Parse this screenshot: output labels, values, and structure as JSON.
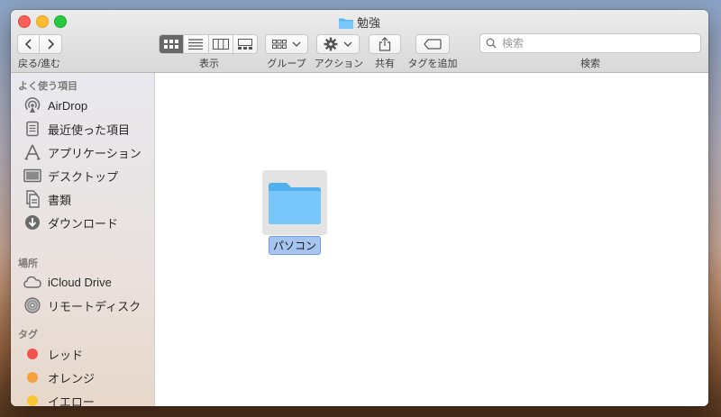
{
  "window": {
    "title": "勉強"
  },
  "toolbar": {
    "nav_label": "戻る/進む",
    "view_label": "表示",
    "group_label": "グループ",
    "action_label": "アクション",
    "share_label": "共有",
    "tag_label": "タグを追加",
    "search_label": "検索",
    "search_placeholder": "検索",
    "view_modes": [
      "icon-view-icon",
      "list-view-icon",
      "column-view-icon",
      "gallery-view-icon"
    ],
    "active_view": "icon-view-icon"
  },
  "sidebar": {
    "favorites_header": "よく使う項目",
    "favorites": [
      {
        "label": "AirDrop",
        "icon": "airdrop-icon"
      },
      {
        "label": "最近使った項目",
        "icon": "recents-icon"
      },
      {
        "label": "アプリケーション",
        "icon": "applications-icon"
      },
      {
        "label": "デスクトップ",
        "icon": "desktop-icon"
      },
      {
        "label": "書類",
        "icon": "documents-icon"
      },
      {
        "label": "ダウンロード",
        "icon": "downloads-icon"
      }
    ],
    "locations_header": "場所",
    "locations": [
      {
        "label": "iCloud Drive",
        "icon": "cloud-icon"
      },
      {
        "label": "リモートディスク",
        "icon": "remote-disc-icon"
      }
    ],
    "tags_header": "タグ",
    "tags": [
      {
        "label": "レッド",
        "color": "#f0524f"
      },
      {
        "label": "オレンジ",
        "color": "#f5a03a"
      },
      {
        "label": "イエロー",
        "color": "#f7c52f"
      }
    ]
  },
  "content": {
    "items": [
      {
        "name": "パソコン",
        "icon": "folder-icon",
        "selected": true
      }
    ]
  }
}
